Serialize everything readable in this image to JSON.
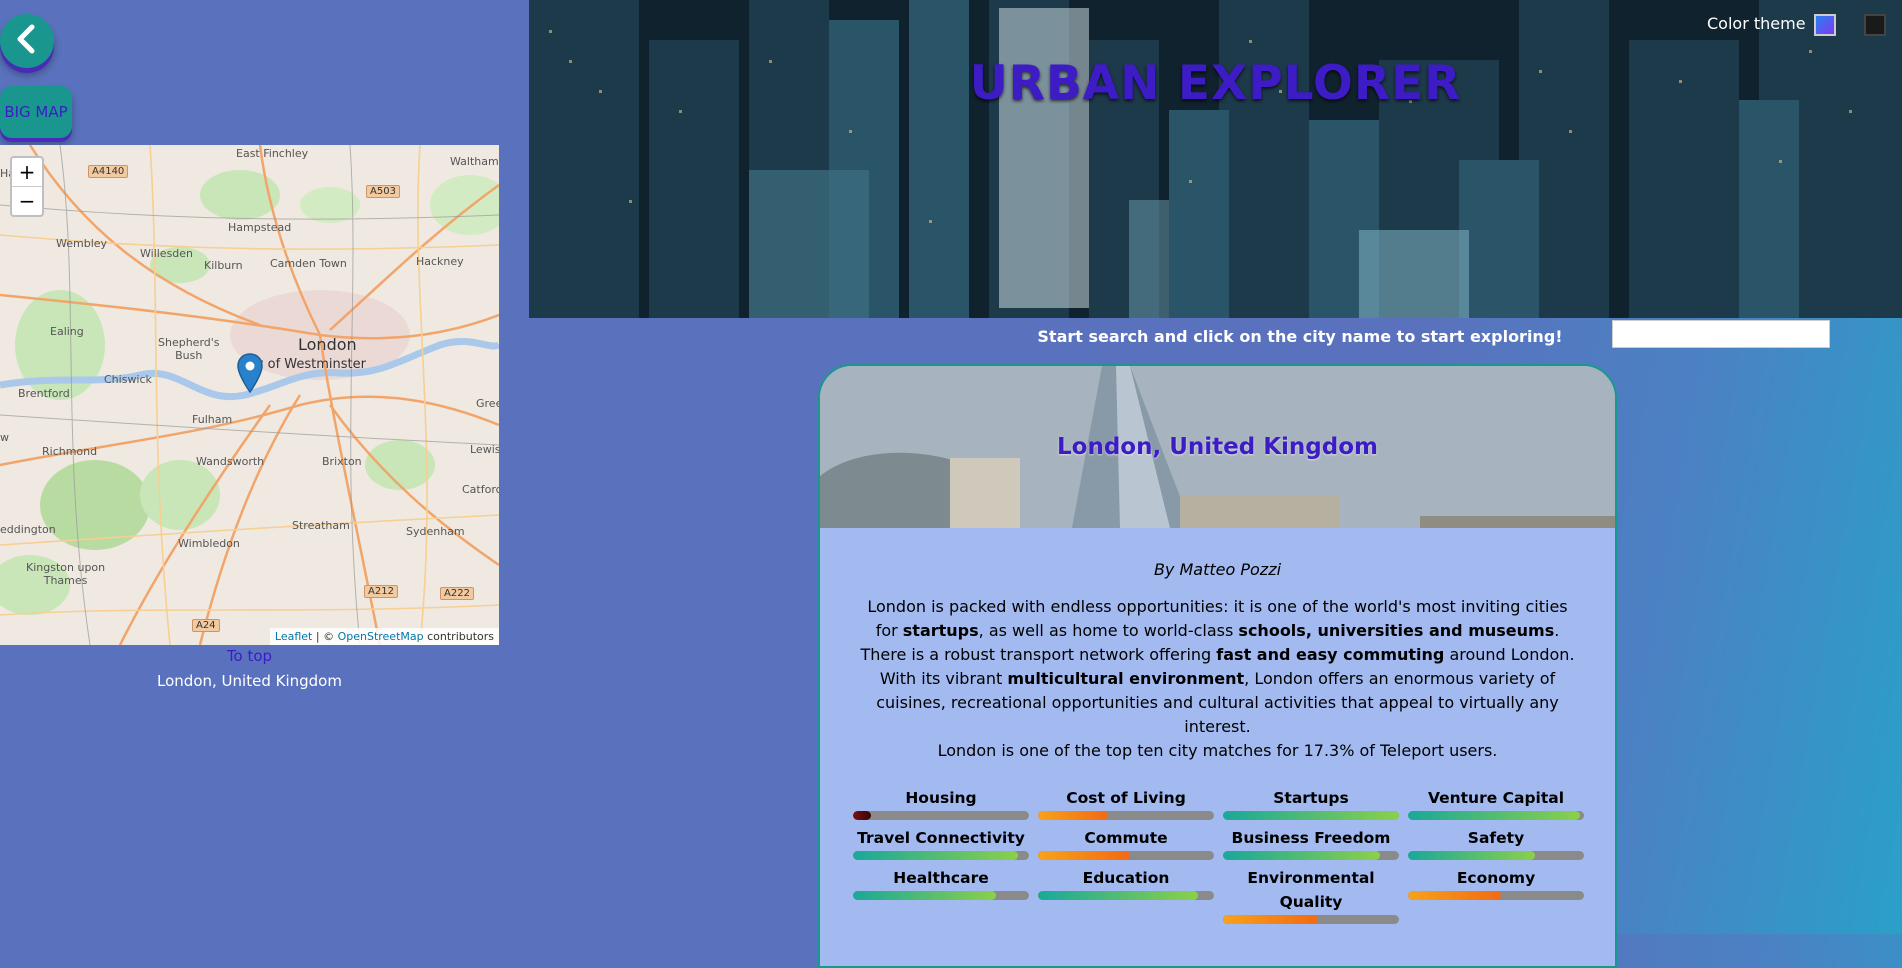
{
  "nav": {
    "back_icon": "chevron-left-icon",
    "big_map_label": "BIG MAP"
  },
  "map": {
    "zoom_in": "+",
    "zoom_out": "−",
    "labels": {
      "east_finchley": "East Finchley",
      "walthamstow": "Walthams",
      "hampstead": "Hampstead",
      "wembley": "Wembley",
      "willesden": "Willesden",
      "kilburn": "Kilburn",
      "camden_town": "Camden Town",
      "hackney": "Hackney",
      "ealing": "Ealing",
      "shepherds_bush": "Shepherd's\nBush",
      "london": "London",
      "westminster": "City of Westminster",
      "brentford": "Brentford",
      "chiswick": "Chiswick",
      "fulham": "Fulham",
      "richmond": "Richmond",
      "wandsworth": "Wandsworth",
      "brixton": "Brixton",
      "lewisham": "Lewis",
      "catford": "Catford",
      "streatham": "Streatham",
      "wimbledon": "Wimbledon",
      "sydenham": "Sydenham",
      "teddington": "eddington",
      "kingston": "Kingston upon\nThames",
      "green": "Gree",
      "ha": "Ha",
      "w": "w"
    },
    "roads": {
      "a4140": "A4140",
      "a503": "A503",
      "a212": "A212",
      "a222": "A222",
      "a24": "A24"
    },
    "attribution": {
      "leaflet": "Leaflet",
      "sep": " | © ",
      "osm": "OpenStreetMap",
      "contributors": " contributors"
    },
    "to_top": "To top",
    "caption": "London, United Kingdom"
  },
  "header": {
    "title": "URBAN EXPLORER",
    "color_theme_label": "Color theme",
    "theme_colors": {
      "light": "#4a6ff0",
      "dark": "#1a1a1a"
    }
  },
  "search": {
    "hint": "Start search and click on the city name to start exploring!",
    "value": ""
  },
  "city": {
    "title": "London, United Kingdom",
    "author": "By Matteo Pozzi",
    "summary": [
      {
        "t": "London is packed with endless opportunities: it is one of the world's most inviting cities for "
      },
      {
        "t": "startups",
        "b": true
      },
      {
        "t": ", as well as home to world-class "
      },
      {
        "t": "schools, universities and museums",
        "b": true
      },
      {
        "t": ". There is a robust transport network offering "
      },
      {
        "t": "fast and easy commuting",
        "b": true
      },
      {
        "t": " around London. With its vibrant "
      },
      {
        "t": "multicultural environment",
        "b": true
      },
      {
        "t": ", London offers an enormous variety of cuisines, recreational opportunities and cultural activities that appeal to virtually any interest."
      }
    ],
    "teleport_line": "London is one of the top ten city matches for 17.3% of Teleport users.",
    "scores": [
      {
        "label": "Housing",
        "value": 0.1,
        "color": "dark-red"
      },
      {
        "label": "Cost of Living",
        "value": 0.4,
        "color": "orange"
      },
      {
        "label": "Startups",
        "value": 1.0,
        "color": "green"
      },
      {
        "label": "Venture Capital",
        "value": 0.98,
        "color": "green"
      },
      {
        "label": "Travel Connectivity",
        "value": 0.94,
        "color": "green"
      },
      {
        "label": "Commute",
        "value": 0.52,
        "color": "orange"
      },
      {
        "label": "Business Freedom",
        "value": 0.89,
        "color": "green"
      },
      {
        "label": "Safety",
        "value": 0.72,
        "color": "green"
      },
      {
        "label": "Healthcare",
        "value": 0.81,
        "color": "green"
      },
      {
        "label": "Education",
        "value": 0.91,
        "color": "green"
      },
      {
        "label": "Environmental\nQuality",
        "value": 0.54,
        "color": "orange"
      },
      {
        "label": "Economy",
        "value": 0.53,
        "color": "orange"
      }
    ],
    "score_colors": {
      "green": [
        "#1aa89a",
        "#8bd04a"
      ],
      "orange": [
        "#f7a21a",
        "#f26a14"
      ],
      "dark-red": [
        "#7a1010",
        "#3a0505"
      ]
    }
  }
}
